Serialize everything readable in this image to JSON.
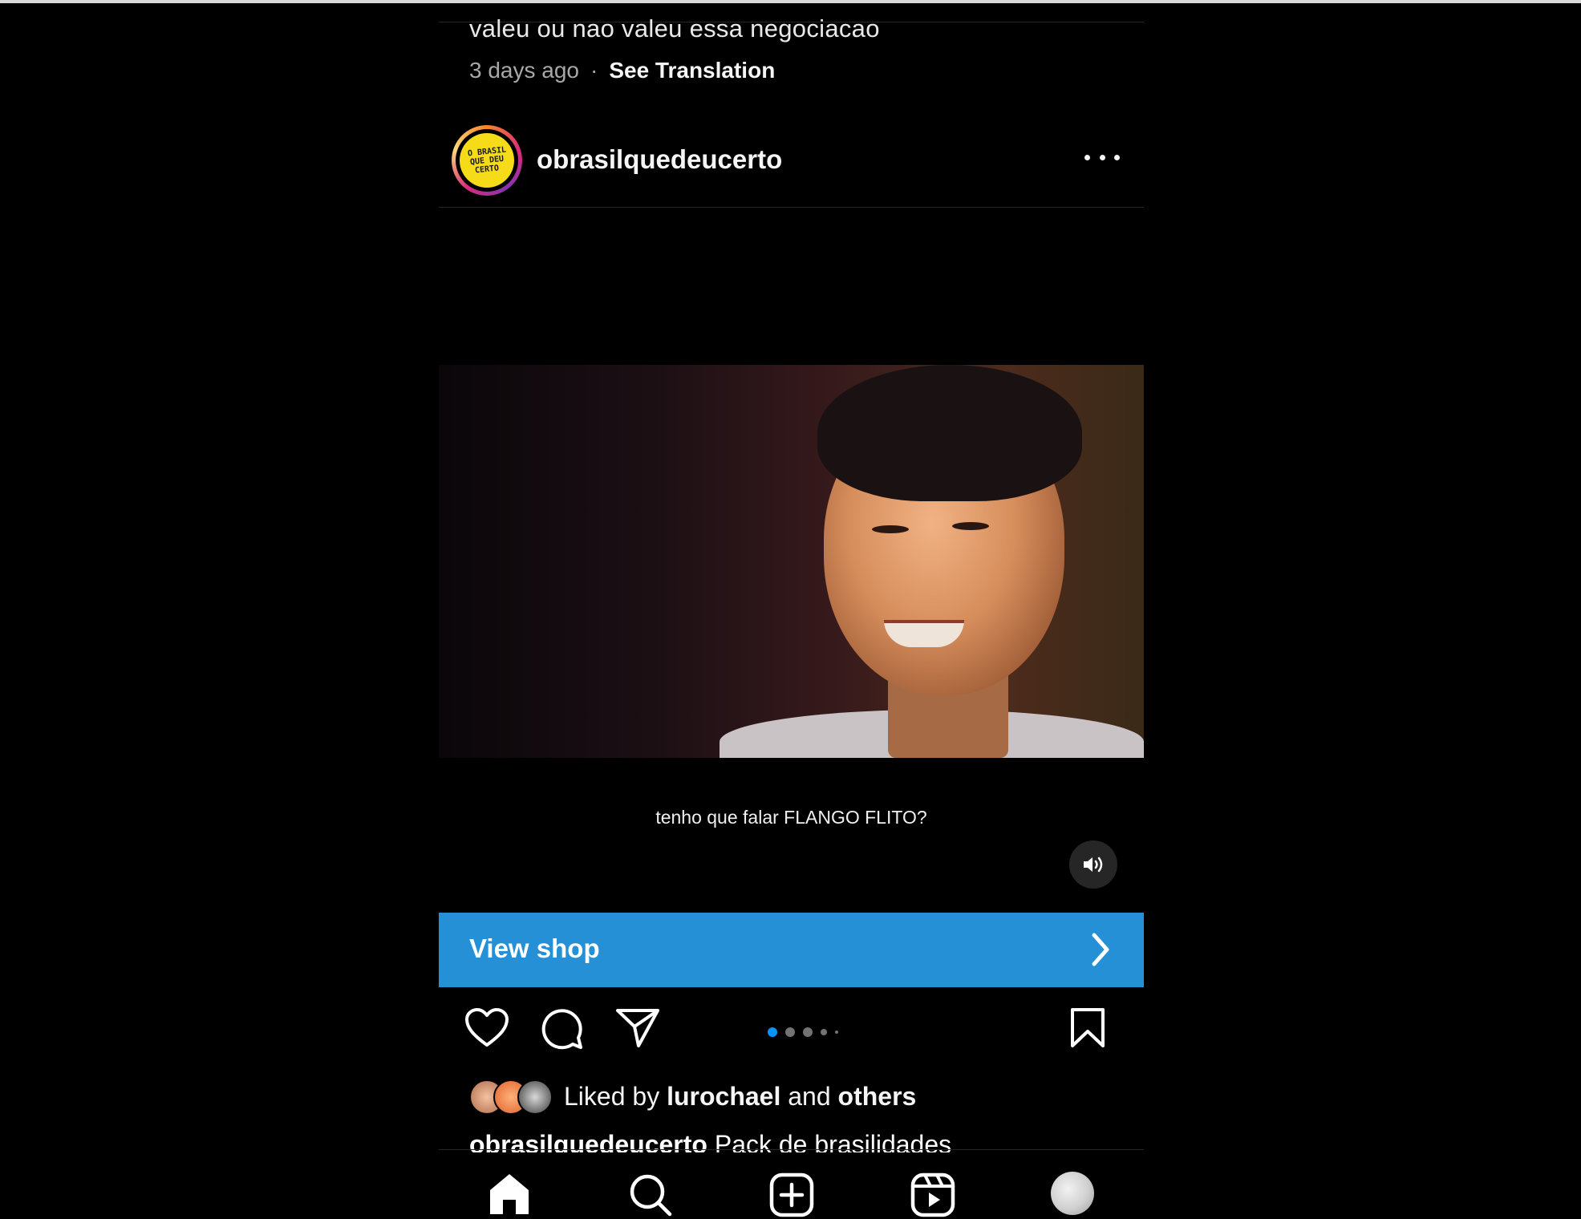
{
  "comment": {
    "text": "valeu ou nao valeu essa negociacao",
    "time": "3 days ago",
    "separator": "·",
    "see_translation": "See Translation"
  },
  "post": {
    "username": "obrasilquedeucerto",
    "avatar_logo_lines": [
      "O BRASIL",
      "QUE DEU",
      "CERTO"
    ],
    "subtitle": "tenho que falar FLANGO FLITO?",
    "shop_label": "View shop",
    "carousel": {
      "total": 5,
      "current": 1
    },
    "likes": {
      "prefix": "Liked by",
      "user": "lurochael",
      "middle": "and",
      "others": "others"
    },
    "caption_user": "obrasilquedeucerto",
    "caption_text": "Pack de brasilidades"
  },
  "icons": {
    "more": "more-horizontal-icon",
    "sound": "speaker-icon",
    "shop": "chevron-right-icon",
    "like": "heart-icon",
    "comment": "comment-icon",
    "share": "send-icon",
    "save": "bookmark-icon"
  },
  "nav": {
    "items": [
      "home-icon",
      "search-icon",
      "create-icon",
      "reels-icon",
      "profile-avatar"
    ]
  },
  "colors": {
    "background": "#000000",
    "accent": "#2690d6",
    "carousel_active": "#0095f6",
    "text": "#f5f5f5",
    "muted": "#a8a8a8"
  }
}
